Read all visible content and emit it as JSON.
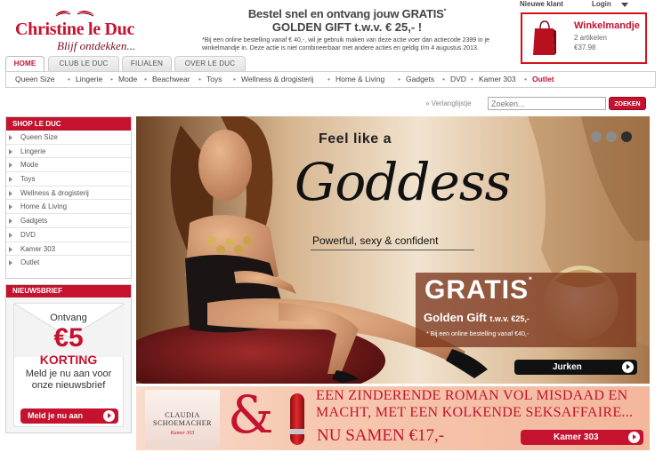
{
  "colors": {
    "brand": "#c4122f",
    "nav_border": "#cfcfcf",
    "hero_overlay": "#78321a"
  },
  "logo": {
    "brand": "Christine le Duc",
    "tagline": "Blijf ontdekken..."
  },
  "promo": {
    "line1": "Bestel snel en ontvang jouw GRATIS",
    "line1_sup": "*",
    "line2": "GOLDEN GIFT t.w.v. € 25,- !",
    "fine": "*Bij een online bestelling vanaf € 40,-, wil je gebruik maken van deze actie voer dan actiecode 2399 in je winkelmandje in. Deze actie is niet combineerbaar met andere acties en geldig t/m 4 augustus 2013."
  },
  "account": {
    "new_customer": "Nieuwe klant",
    "login": "Login"
  },
  "cart": {
    "title": "Winkelmandje",
    "items": "2 artikelen",
    "price": "€37.98",
    "icon": "shopping-bag-icon"
  },
  "tabs": [
    {
      "label": "HOME",
      "active": true
    },
    {
      "label": "CLUB LE DUC",
      "active": false
    },
    {
      "label": "FILIALEN",
      "active": false
    },
    {
      "label": "OVER LE DUC",
      "active": false
    }
  ],
  "categories": [
    "Queen Size",
    "Lingerie",
    "Mode",
    "Beachwear",
    "Toys",
    "Wellness & drogisterij",
    "Home & Living",
    "Gadgets",
    "DVD",
    "Kamer 303",
    "Outlet"
  ],
  "search": {
    "wishlist": "» Verlanglijstje",
    "placeholder": "Zoeken...",
    "button": "ZOEKEN"
  },
  "sidebar": {
    "title": "SHOP LE DUC",
    "items": [
      "Queen Size",
      "Lingerie",
      "Mode",
      "Toys",
      "Wellness & drogisterij",
      "Home & Living",
      "Gadgets",
      "DVD",
      "Kamer 303",
      "Outlet"
    ]
  },
  "newsletter": {
    "title": "NIEUWSBRIEF",
    "ontvang": "Ontvang",
    "amount": "€5",
    "korting": "KORTING",
    "meld_line1": "Meld je nu aan voor",
    "meld_line2": "onze nieuwsbrief",
    "button": "Meld je nu aan"
  },
  "hero": {
    "feel": "Feel like a",
    "goddess": "Goddess",
    "tagline": "Powerful, sexy & confident",
    "gratis": "GRATIS",
    "gratis_sup": "*",
    "golden_gift": "Golden Gift",
    "golden_twv": "t.w.v. €25,-",
    "condition": "* Bij een online bestelling vanaf €40,-",
    "button": "Jurken",
    "slide_count": 3,
    "active_slide": 3
  },
  "banner": {
    "book_author_first": "CLAUDIA",
    "book_author_last": "SCHOEMACHER",
    "book_title": "Kamer 303",
    "amp": "&",
    "line1": "EEN ZINDERENDE ROMAN VOL MISDAAD EN",
    "line2": "MACHT, MET EEN KOLKENDE SEKSAFFAIRE...",
    "samen": "NU SAMEN €17,-",
    "button": "Kamer 303"
  }
}
